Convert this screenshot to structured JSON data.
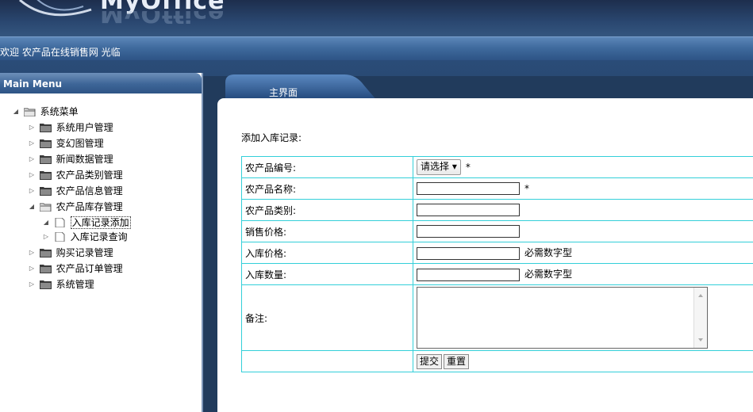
{
  "header": {
    "logo_text": "MyOffice"
  },
  "welcome": {
    "text": "欢迎 农产品在线销售网 光临"
  },
  "sidebar": {
    "title": "Main Menu",
    "tree": {
      "root": "系统菜单",
      "items": [
        {
          "label": "系统用户管理"
        },
        {
          "label": "变幻图管理"
        },
        {
          "label": "新闻数据管理"
        },
        {
          "label": "农产品类别管理"
        },
        {
          "label": "农产品信息管理"
        },
        {
          "label": "农产品库存管理",
          "children": [
            {
              "label": "入库记录添加"
            },
            {
              "label": "入库记录查询"
            }
          ]
        },
        {
          "label": "购买记录管理"
        },
        {
          "label": "农产品订单管理"
        },
        {
          "label": "系统管理"
        }
      ]
    }
  },
  "main": {
    "tab_label": "主界面",
    "form_title": "添加入库记录:",
    "fields": {
      "product_id": {
        "label": "农产品编号:",
        "select_value": "请选择",
        "required": "*"
      },
      "product_name": {
        "label": "农产品名称:",
        "value": "",
        "required": "*"
      },
      "category": {
        "label": "农产品类别:",
        "value": ""
      },
      "sale_price": {
        "label": "销售价格:",
        "value": ""
      },
      "in_price": {
        "label": "入库价格:",
        "value": "",
        "hint": "必需数字型"
      },
      "in_qty": {
        "label": "入库数量:",
        "value": "",
        "hint": "必需数字型"
      },
      "remark": {
        "label": "备注:",
        "value": ""
      }
    },
    "buttons": {
      "submit": "提交",
      "reset": "重置"
    }
  },
  "colors": {
    "header": "#1d2e4d",
    "accent": "#3d6597",
    "table_border": "#33cfd9"
  }
}
